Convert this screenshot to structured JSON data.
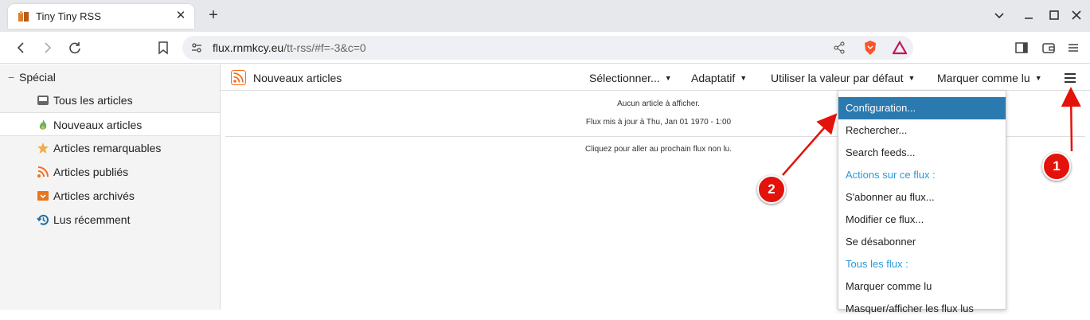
{
  "browser": {
    "tab_title": "Tiny Tiny RSS",
    "url_host": "flux.rnmkcy.eu",
    "url_path": "/tt-rss/#f=-3&c=0"
  },
  "sidebar": {
    "category": "Spécial",
    "items": [
      {
        "label": "Tous les articles",
        "icon": "inbox-icon"
      },
      {
        "label": "Nouveaux articles",
        "icon": "fire-icon"
      },
      {
        "label": "Articles remarquables",
        "icon": "star-icon"
      },
      {
        "label": "Articles publiés",
        "icon": "rss-icon"
      },
      {
        "label": "Articles archivés",
        "icon": "archive-icon"
      },
      {
        "label": "Lus récemment",
        "icon": "history-icon"
      }
    ],
    "selected": "Nouveaux articles"
  },
  "toolbar": {
    "feed_title": "Nouveaux articles",
    "select_label": "Sélectionner...",
    "view_mode_label": "Adaptatif",
    "order_label": "Utiliser la valeur par défaut",
    "mark_read_label": "Marquer comme lu"
  },
  "headlines": {
    "no_articles": "Aucun article à afficher.",
    "updated": "Flux mis à jour à Thu, Jan 01 1970 - 1:00",
    "next_feed": "Cliquez pour aller au prochain flux non lu."
  },
  "menu": {
    "items": [
      {
        "label": "Configuration...",
        "type": "item",
        "active": true
      },
      {
        "label": "Rechercher...",
        "type": "item"
      },
      {
        "label": "Search feeds...",
        "type": "item"
      },
      {
        "label": "Actions sur ce flux :",
        "type": "header"
      },
      {
        "label": "S'abonner au flux...",
        "type": "item"
      },
      {
        "label": "Modifier ce flux...",
        "type": "item"
      },
      {
        "label": "Se désabonner",
        "type": "item"
      },
      {
        "label": "Tous les flux :",
        "type": "header"
      },
      {
        "label": "Marquer comme lu",
        "type": "item"
      },
      {
        "label": "Masquer/afficher les flux lus",
        "type": "item"
      }
    ]
  },
  "annotations": {
    "badge_1": "1",
    "badge_2": "2"
  },
  "colors": {
    "accent": "#2a7ab0",
    "menu_header": "#2a9ad8",
    "annotation": "#e3120b"
  }
}
